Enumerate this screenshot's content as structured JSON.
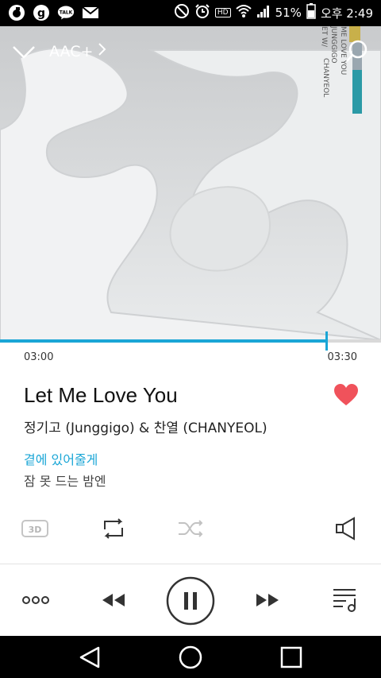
{
  "status_bar": {
    "battery": "51%",
    "time": "오후 2:49",
    "icons": [
      "o-app-icon",
      "g-app-icon",
      "talk-icon",
      "mail-icon",
      "do-not-disturb-icon",
      "alarm-icon",
      "hd-icon",
      "wifi-icon",
      "signal-icon",
      "battery-icon"
    ],
    "hd_label": "HD",
    "talk_label": "TALK"
  },
  "header": {
    "collapse_icon": "chevron-down-icon",
    "codec_label": "AAC+",
    "codec_arrow_icon": "chevron-right-icon",
    "search_icon": "search-icon"
  },
  "album_art": {
    "spine_line1": "ME LOVE YOU",
    "spine_line2": "CHANYEOL",
    "spine_line3": "JUNGGIGO",
    "spine_line4": "ET W/"
  },
  "playback": {
    "elapsed": "03:00",
    "duration": "03:30",
    "progress_fraction": 0.857
  },
  "song": {
    "title": "Let Me Love You",
    "artist": "정기고 (Junggigo) & 찬열 (CHANYEOL)",
    "lyric_current": "곁에 있어줄게",
    "lyric_next": "잠 못 드는 밤엔",
    "liked": true
  },
  "controls": {
    "effect_label": "3D",
    "repeat_icon": "repeat-icon",
    "shuffle_icon": "shuffle-icon",
    "speaker_icon": "speaker-icon",
    "more_icon": "more-icon",
    "prev_icon": "rewind-icon",
    "pause_icon": "pause-icon",
    "next_icon": "fast-forward-icon",
    "playlist_icon": "playlist-icon"
  },
  "colors": {
    "accent": "#1aa6d6",
    "heart": "#f0525b"
  },
  "nav_bar": {
    "back_icon": "back-icon",
    "home_icon": "home-icon",
    "recents_icon": "recents-icon"
  }
}
